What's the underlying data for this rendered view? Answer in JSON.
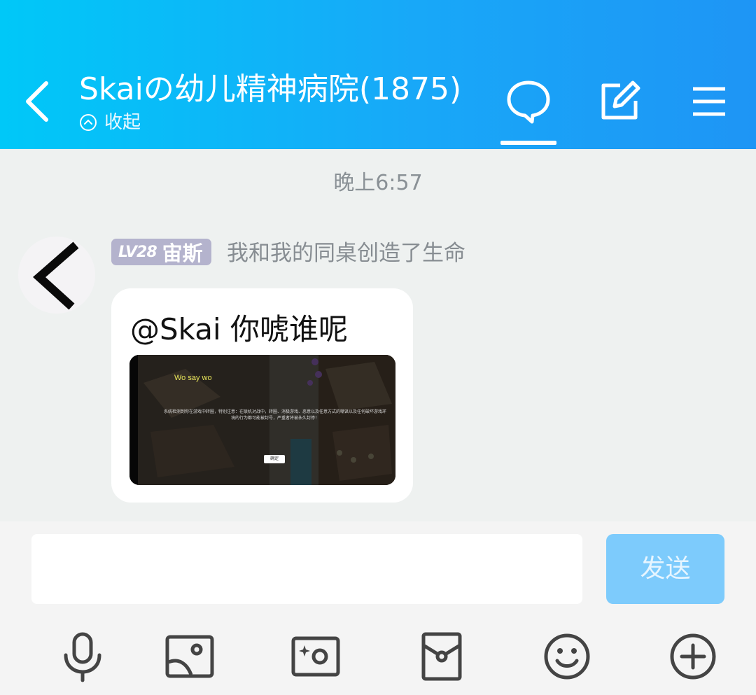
{
  "header": {
    "title": "Skaiの幼儿精神病院(1875)",
    "collapse_label": "收起",
    "icons": [
      "back-icon",
      "chat-bubble-icon",
      "edit-icon",
      "menu-icon"
    ]
  },
  "chat": {
    "time": "晚上6:57",
    "message": {
      "level": "LV28",
      "sender": "宙斯",
      "sender_title": "我和我的同桌创造了生命",
      "text": "@Skai 你唬谁呢",
      "image": {
        "caption": "Wo say wo",
        "notice": "系统检测到你在游戏中转圈，特别注意：在联机对战中，转圈、消极游戏、恶意以及任意方式的嘲讽以及任何破坏游戏环境的行为都可能被封号，严重者将被永久封停！",
        "button": "确定"
      }
    }
  },
  "composer": {
    "input_value": "",
    "send_label": "发送",
    "tools": [
      "microphone-icon",
      "image-icon",
      "camera-icon",
      "red-packet-icon",
      "emoji-icon",
      "plus-icon"
    ]
  },
  "colors": {
    "header_start": "#00c8f8",
    "header_end": "#1e95f5",
    "send_button": "#7dcbfc",
    "level_badge": "#b4b3cd"
  }
}
